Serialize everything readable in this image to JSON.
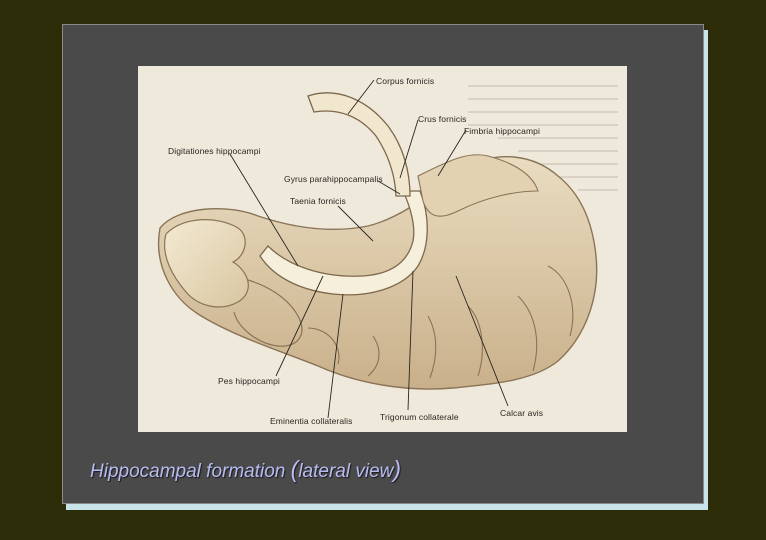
{
  "caption": {
    "text_before": "Hippocampal formation ",
    "paren_open": "(",
    "text_middle": "lateral view",
    "paren_close": ")"
  },
  "figure_labels": {
    "corpus_fornicis": "Corpus fornicis",
    "crus_fornicis": "Crus fornicis",
    "fimbria_hippocampi": "Fimbria hippocampi",
    "digitationes_hippocampi": "Digitationes hippocampi",
    "gyrus_parahippocampalis": "Gyrus parahippocampalis",
    "taenia_fornicis": "Taenia fornicis",
    "pes_hippocampi": "Pes hippocampi",
    "eminentia_collateralis": "Eminentia collateralis",
    "trigonum_collaterale": "Trigonum collaterale",
    "calcar_avis": "Calcar avis"
  },
  "colors": {
    "background": "#2c2c08",
    "slide": "#4a4a4a",
    "slide_shadow": "#c8e4ea",
    "caption": "#b8bcf2",
    "figure_paper": "#efe9dc"
  }
}
